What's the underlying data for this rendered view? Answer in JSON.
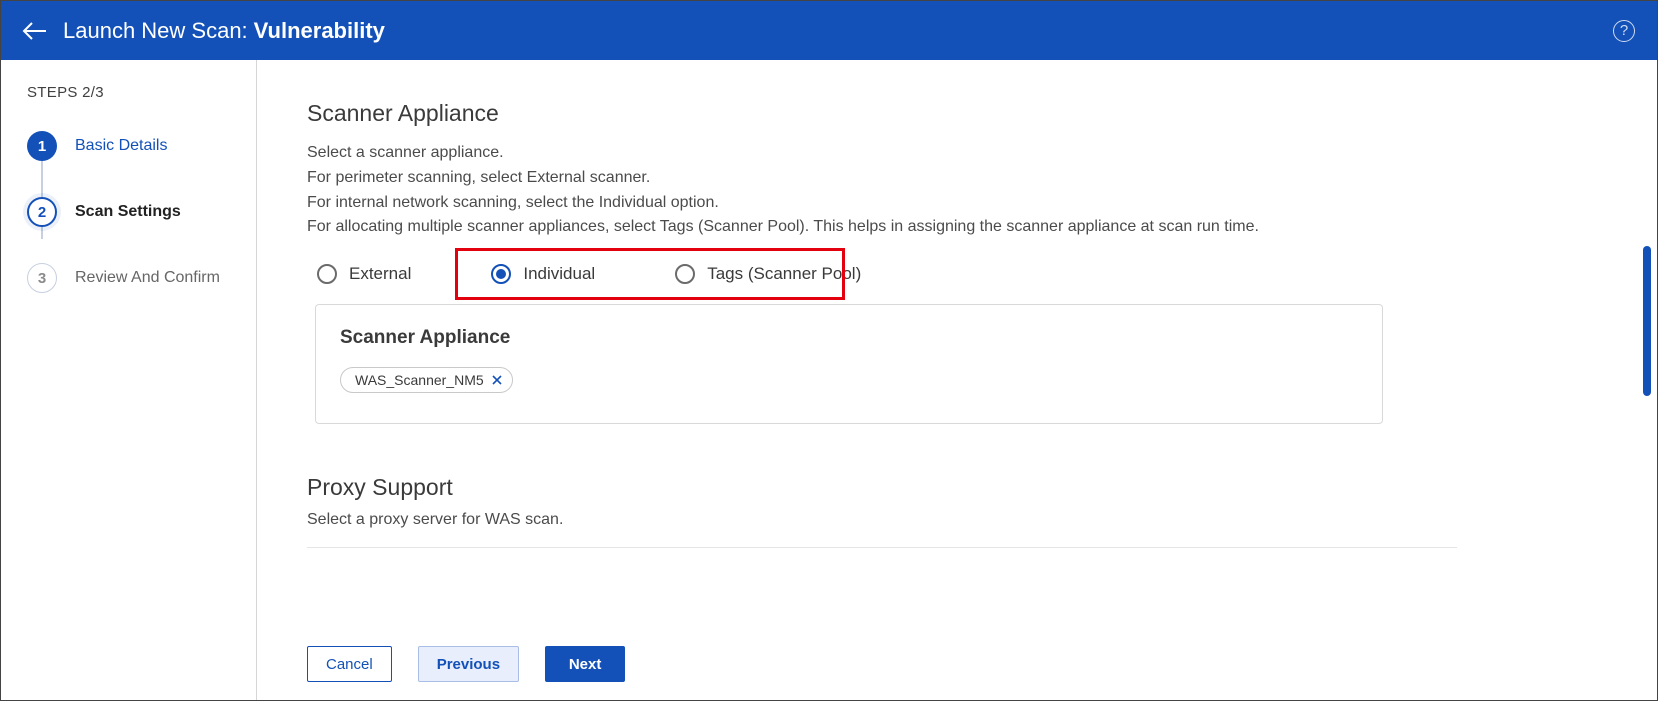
{
  "header": {
    "prefix": "Launch New Scan:",
    "title": "Vulnerability"
  },
  "sidebar": {
    "steps_label": "STEPS 2/3",
    "steps": [
      {
        "num": "1",
        "label": "Basic Details"
      },
      {
        "num": "2",
        "label": "Scan Settings"
      },
      {
        "num": "3",
        "label": "Review And Confirm"
      }
    ]
  },
  "scanner": {
    "title": "Scanner Appliance",
    "desc_line1": "Select a scanner appliance.",
    "desc_line2": "For perimeter scanning, select External scanner.",
    "desc_line3": "For internal network scanning, select the Individual option.",
    "desc_line4": "For allocating multiple scanner appliances, select Tags (Scanner Pool). This helps in assigning the scanner appliance at scan run time.",
    "options": {
      "external": "External",
      "individual": "Individual",
      "tags": "Tags (Scanner Pool)"
    },
    "selected": "individual",
    "box_title": "Scanner Appliance",
    "chip": "WAS_Scanner_NM5"
  },
  "proxy": {
    "title": "Proxy Support",
    "desc": "Select a proxy server for WAS scan."
  },
  "footer": {
    "cancel": "Cancel",
    "previous": "Previous",
    "next": "Next"
  }
}
